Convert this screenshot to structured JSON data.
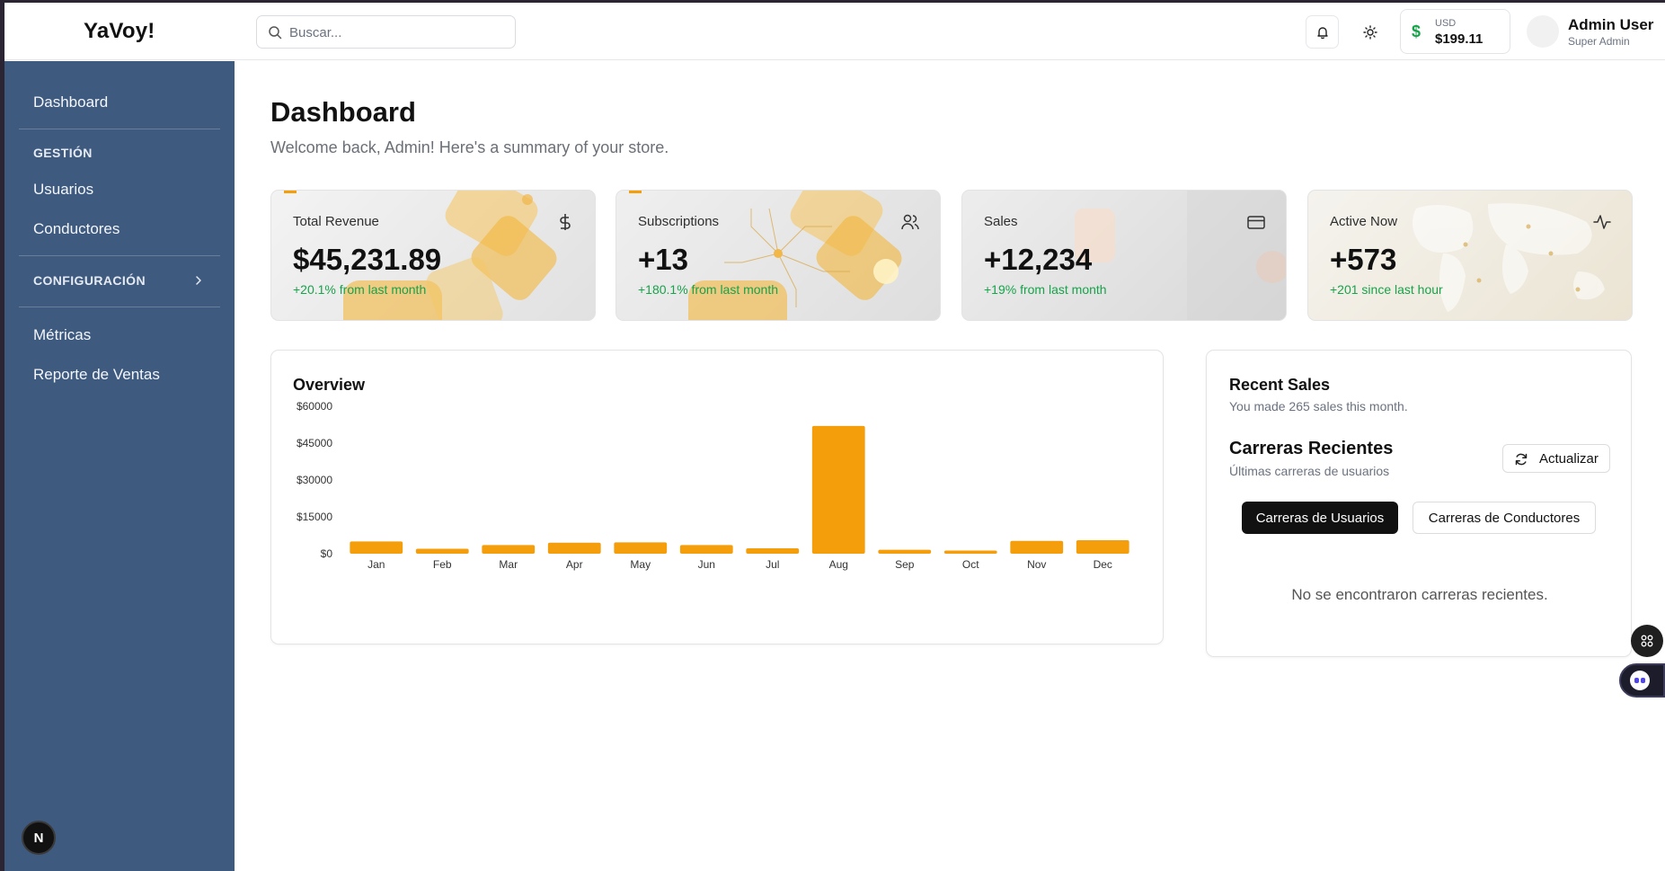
{
  "header": {
    "brand": "YaVoy!",
    "search_placeholder": "Buscar...",
    "wallet": {
      "currency": "USD",
      "amount": "$199.11",
      "symbol": "$"
    },
    "user": {
      "name": "Admin User",
      "role": "Super Admin"
    }
  },
  "sidebar": {
    "dashboard": "Dashboard",
    "section_gestion": "GESTIÓN",
    "usuarios": "Usuarios",
    "conductores": "Conductores",
    "section_config": "CONFIGURACIÓN",
    "metricas": "Métricas",
    "reporte": "Reporte de Ventas",
    "next_badge": "N"
  },
  "page": {
    "title": "Dashboard",
    "subtitle": "Welcome back, Admin! Here's a summary of your store."
  },
  "cards": [
    {
      "label": "Total Revenue",
      "value": "$45,231.89",
      "delta": "+20.1% from last month",
      "icon": "dollar-icon"
    },
    {
      "label": "Subscriptions",
      "value": "+13",
      "delta": "+180.1% from last month",
      "icon": "users-icon"
    },
    {
      "label": "Sales",
      "value": "+12,234",
      "delta": "+19% from last month",
      "icon": "credit-card-icon"
    },
    {
      "label": "Active Now",
      "value": "+573",
      "delta": "+201 since last hour",
      "icon": "activity-icon"
    }
  ],
  "overview": {
    "title": "Overview"
  },
  "chart_data": {
    "type": "bar",
    "title": "Overview",
    "categories": [
      "Jan",
      "Feb",
      "Mar",
      "Apr",
      "May",
      "Jun",
      "Jul",
      "Aug",
      "Sep",
      "Oct",
      "Nov",
      "Dec"
    ],
    "values": [
      5000,
      2000,
      3500,
      4500,
      4600,
      3500,
      2200,
      52000,
      1600,
      1300,
      5200,
      5500
    ],
    "ylim": [
      0,
      60000
    ],
    "yticks": [
      0,
      15000,
      30000,
      45000,
      60000
    ],
    "ytick_labels": [
      "$0",
      "$15000",
      "$30000",
      "$45000",
      "$60000"
    ],
    "color": "#f59e0b",
    "grid": false
  },
  "recent": {
    "title": "Recent Sales",
    "subtitle": "You made 265 sales this month.",
    "carreras_title": "Carreras Recientes",
    "carreras_subtitle": "Últimas carreras de usuarios",
    "refresh_label": "Actualizar",
    "tab_users": "Carreras de Usuarios",
    "tab_drivers": "Carreras de Conductores",
    "empty": "No se encontraron carreras recientes."
  },
  "colors": {
    "sidebar": "#3f5a7f",
    "accent": "#f59e0b",
    "positive": "#16a34a"
  }
}
